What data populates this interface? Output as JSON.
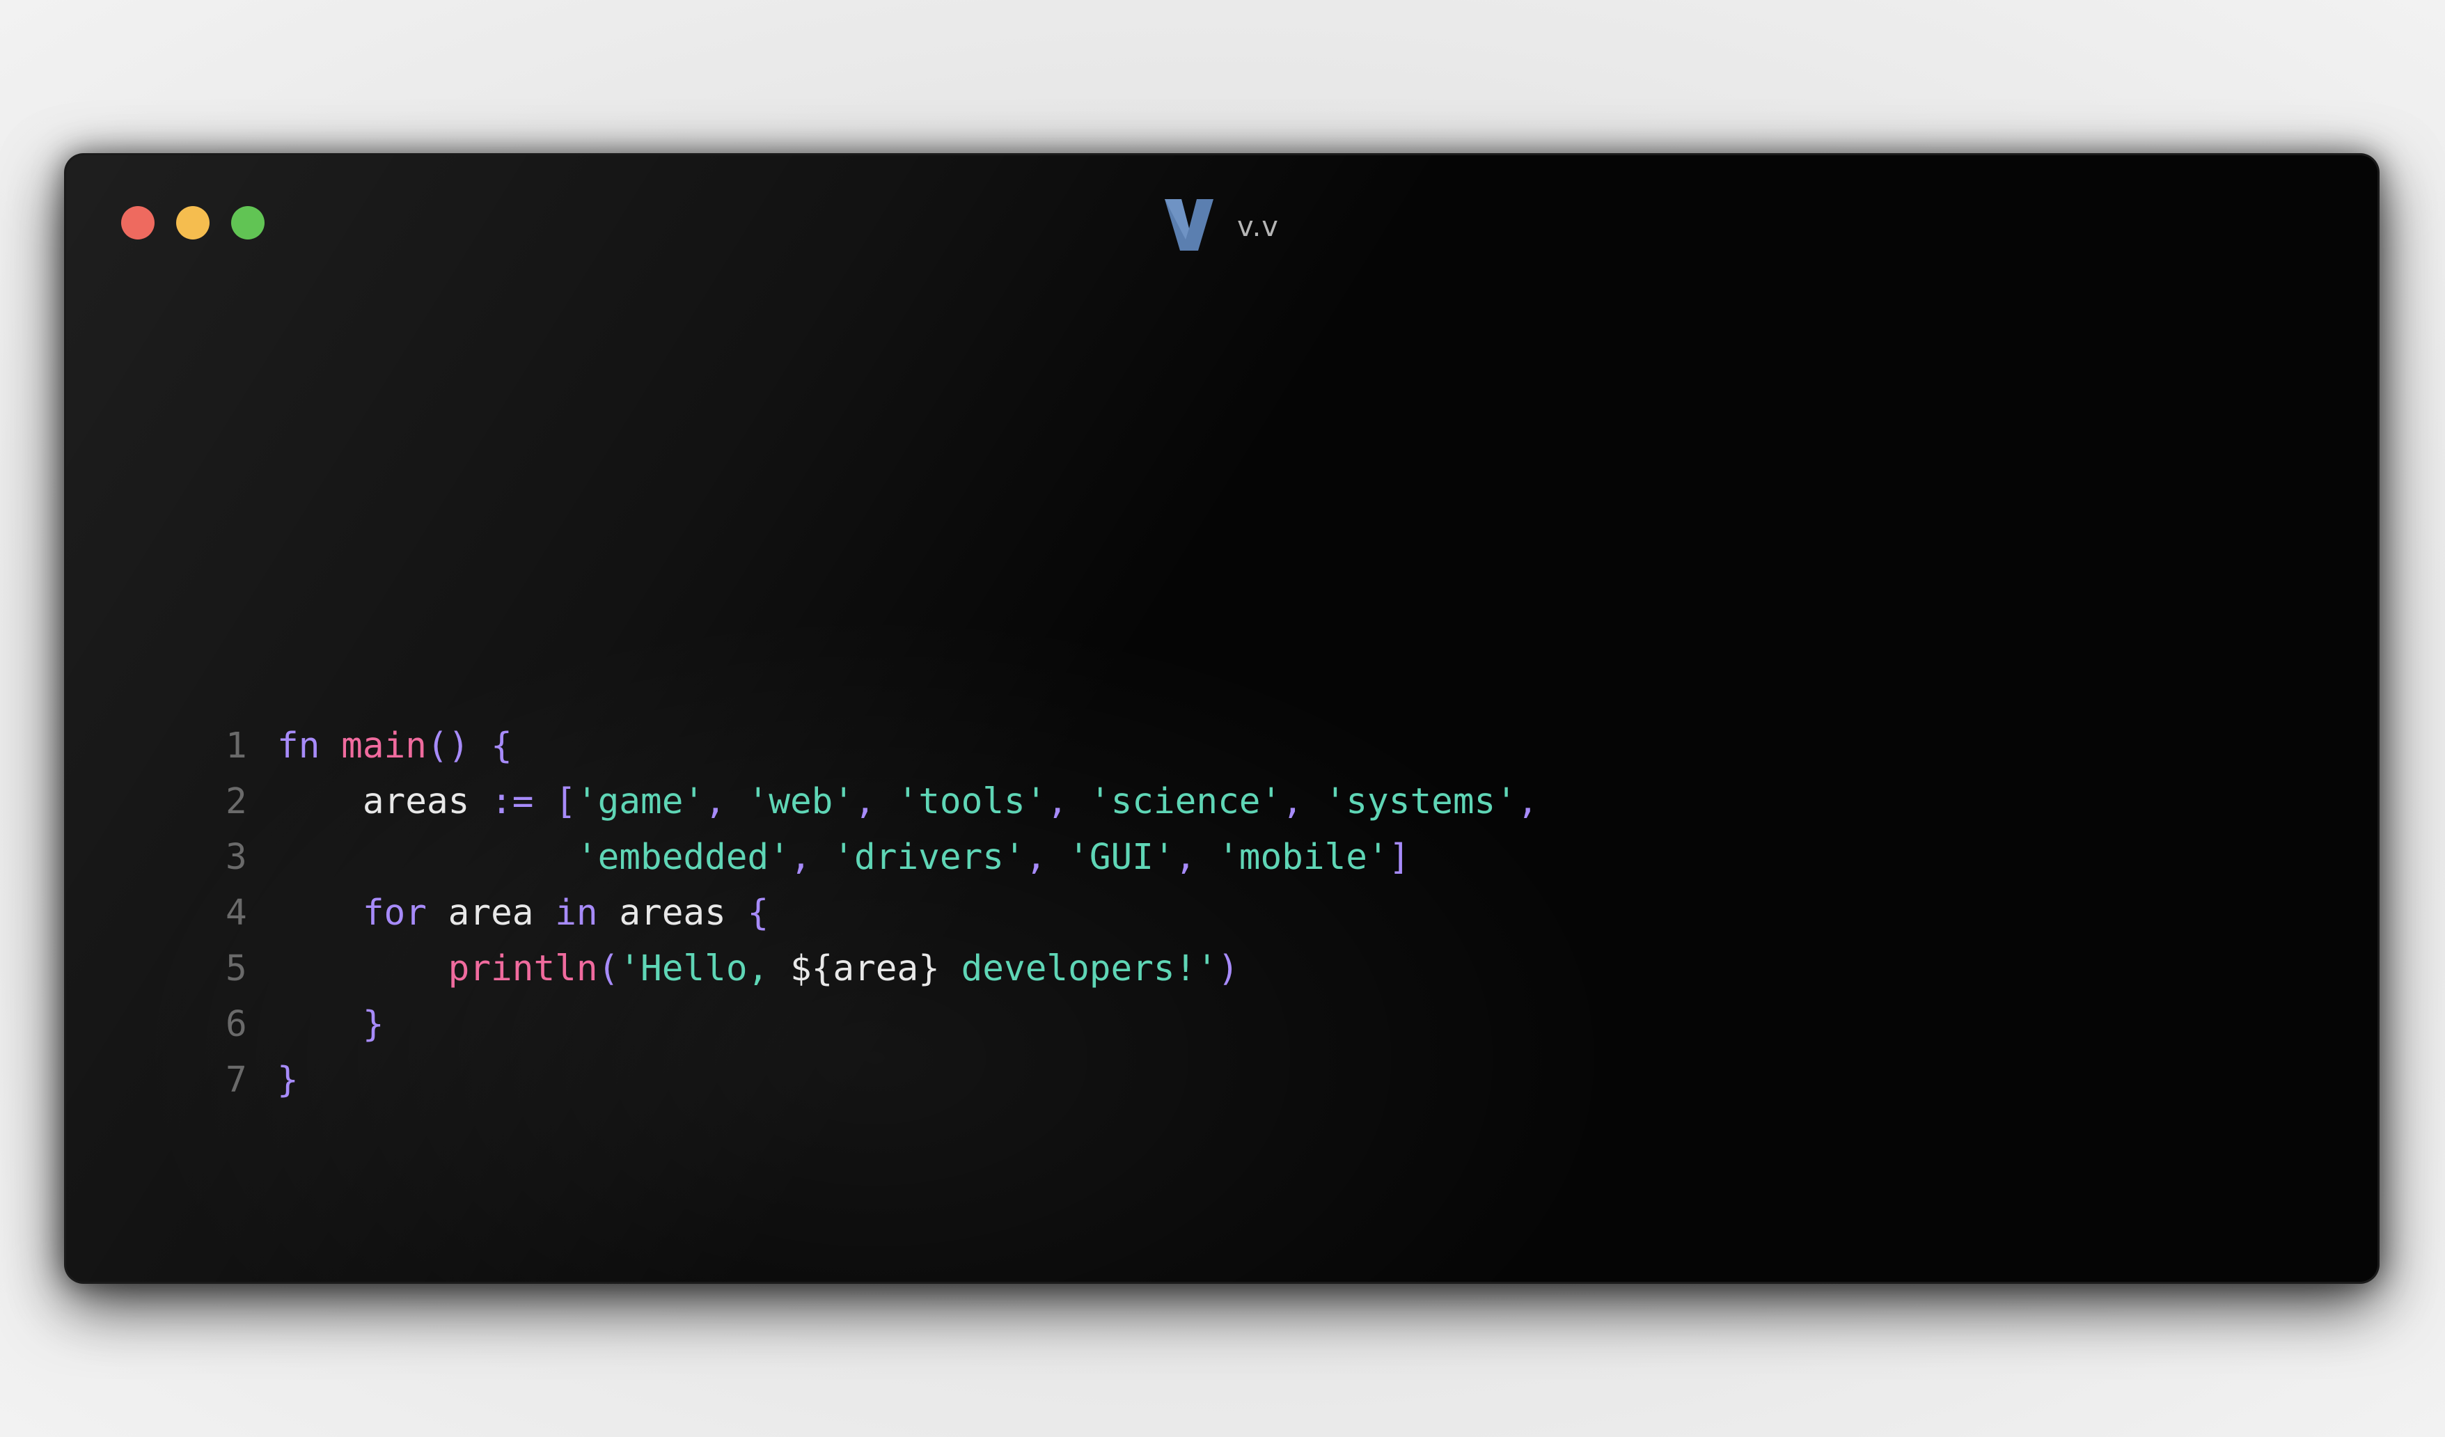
{
  "window": {
    "title": "v.v",
    "logo_icon": "v-language-logo-icon",
    "buttons": [
      {
        "name": "close",
        "color": "#ee6a5f"
      },
      {
        "name": "minimize",
        "color": "#f5bd4f"
      },
      {
        "name": "maximize",
        "color": "#61c454"
      }
    ]
  },
  "colors": {
    "background": "#050505",
    "keyword": "#a78bfa",
    "function": "#f06b9e",
    "string": "#5fd6b6",
    "text": "#e8e8e8",
    "line_number": "#6a6a6a",
    "logo": "#5b7fb0"
  },
  "code": {
    "line_numbers": [
      "1",
      "2",
      "3",
      "4",
      "5",
      "6",
      "7"
    ],
    "lines": [
      [
        {
          "t": "fn",
          "c": "kw"
        },
        {
          "t": " ",
          "c": "plain"
        },
        {
          "t": "main",
          "c": "fn"
        },
        {
          "t": "() {",
          "c": "pun"
        }
      ],
      [
        {
          "t": "    ",
          "c": "plain"
        },
        {
          "t": "areas",
          "c": "plain"
        },
        {
          "t": " := [",
          "c": "pun"
        },
        {
          "t": "'game'",
          "c": "str"
        },
        {
          "t": ", ",
          "c": "pun"
        },
        {
          "t": "'web'",
          "c": "str"
        },
        {
          "t": ", ",
          "c": "pun"
        },
        {
          "t": "'tools'",
          "c": "str"
        },
        {
          "t": ", ",
          "c": "pun"
        },
        {
          "t": "'science'",
          "c": "str"
        },
        {
          "t": ", ",
          "c": "pun"
        },
        {
          "t": "'systems'",
          "c": "str"
        },
        {
          "t": ",",
          "c": "pun"
        }
      ],
      [
        {
          "t": "              ",
          "c": "plain"
        },
        {
          "t": "'embedded'",
          "c": "str"
        },
        {
          "t": ", ",
          "c": "pun"
        },
        {
          "t": "'drivers'",
          "c": "str"
        },
        {
          "t": ", ",
          "c": "pun"
        },
        {
          "t": "'GUI'",
          "c": "str"
        },
        {
          "t": ", ",
          "c": "pun"
        },
        {
          "t": "'mobile'",
          "c": "str"
        },
        {
          "t": "]",
          "c": "pun"
        }
      ],
      [
        {
          "t": "    ",
          "c": "plain"
        },
        {
          "t": "for",
          "c": "kw"
        },
        {
          "t": " area ",
          "c": "plain"
        },
        {
          "t": "in",
          "c": "kw"
        },
        {
          "t": " areas ",
          "c": "plain"
        },
        {
          "t": "{",
          "c": "pun"
        }
      ],
      [
        {
          "t": "        ",
          "c": "plain"
        },
        {
          "t": "println",
          "c": "fn"
        },
        {
          "t": "(",
          "c": "pun"
        },
        {
          "t": "'Hello, ",
          "c": "str"
        },
        {
          "t": "${area}",
          "c": "plain"
        },
        {
          "t": " developers!'",
          "c": "str"
        },
        {
          "t": ")",
          "c": "pun"
        }
      ],
      [
        {
          "t": "    ",
          "c": "plain"
        },
        {
          "t": "}",
          "c": "pun"
        }
      ],
      [
        {
          "t": "}",
          "c": "pun"
        }
      ]
    ]
  }
}
